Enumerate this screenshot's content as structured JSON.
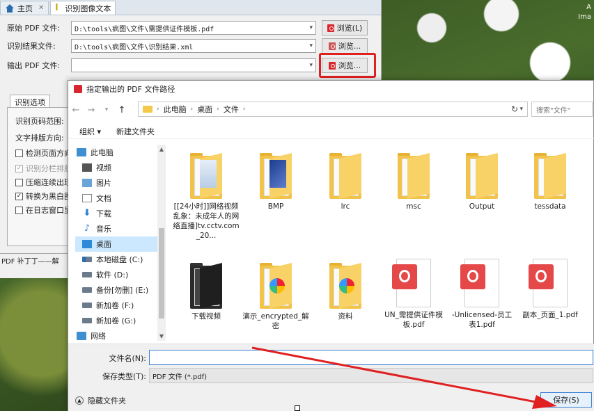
{
  "desktop": {
    "text_line1": "A",
    "text_line2": "Ima"
  },
  "app": {
    "tabs": [
      {
        "label": "主页"
      },
      {
        "label": "识别图像文本"
      }
    ],
    "rows": {
      "source": {
        "label": "原始 PDF 文件:",
        "value": "D:\\tools\\疯图\\文件\\需提供证件模板.pdf",
        "browse": "浏览(L)"
      },
      "result": {
        "label": "识别结果文件:",
        "value": "D:\\tools\\疯图\\文件\\识别结果.xml",
        "browse": "浏览..."
      },
      "output": {
        "label": "输出 PDF 文件:",
        "value": "",
        "browse": "浏览..."
      }
    },
    "options_tab": "识别选项",
    "page_range_label": "识别页码范围:",
    "text_dir_label": "文字排版方向:",
    "checkboxes": [
      {
        "label": "检测页面方向",
        "checked": "",
        "disabled": false
      },
      {
        "label": "识别分栏排版",
        "checked": "✓",
        "disabled": true
      },
      {
        "label": "压缩连续出现",
        "checked": "",
        "disabled": false
      },
      {
        "label": "转换为黑白图",
        "checked": "✓",
        "disabled": false
      },
      {
        "label": "在日志窗口显",
        "checked": "",
        "disabled": false
      }
    ],
    "status": "PDF 补丁丁——解"
  },
  "dialog": {
    "title": "指定输出的 PDF 文件路径",
    "breadcrumb": [
      "此电脑",
      "桌面",
      "文件"
    ],
    "search_placeholder": "搜索\"文件\"",
    "toolbar": {
      "organize": "组织 ▾",
      "new_folder": "新建文件夹"
    },
    "sidebar": [
      {
        "label": "此电脑",
        "icon": "computer-icon"
      },
      {
        "label": "视频",
        "icon": "video-icon"
      },
      {
        "label": "图片",
        "icon": "picture-icon"
      },
      {
        "label": "文档",
        "icon": "document-icon"
      },
      {
        "label": "下载",
        "icon": "download-icon"
      },
      {
        "label": "音乐",
        "icon": "music-icon"
      },
      {
        "label": "桌面",
        "icon": "desktop-icon"
      },
      {
        "label": "本地磁盘 (C:)",
        "icon": "drive-icon"
      },
      {
        "label": "软件 (D:)",
        "icon": "drive-icon"
      },
      {
        "label": "备份[勿删] (E:)",
        "icon": "drive-icon"
      },
      {
        "label": "新加卷 (F:)",
        "icon": "drive-icon"
      },
      {
        "label": "新加卷 (G:)",
        "icon": "drive-icon"
      },
      {
        "label": "网络",
        "icon": "network-icon"
      }
    ],
    "files": [
      {
        "label": "[[24小时]]网络视频乱象：未成年人的网络直播]tv.cctv.com_20...",
        "kind": "folder-doc"
      },
      {
        "label": "BMP",
        "kind": "folder-img"
      },
      {
        "label": "lrc",
        "kind": "folder"
      },
      {
        "label": "msc",
        "kind": "folder"
      },
      {
        "label": "Output",
        "kind": "folder"
      },
      {
        "label": "tessdata",
        "kind": "folder"
      },
      {
        "label": "下载视频",
        "kind": "folder-dark"
      },
      {
        "label": "演示_encrypted_解密",
        "kind": "folder-chart"
      },
      {
        "label": "资料",
        "kind": "folder-chart"
      },
      {
        "label": "UN_需提供证件模板.pdf",
        "kind": "pdf"
      },
      {
        "label": "-Unlicensed-员工表1.pdf",
        "kind": "pdf"
      },
      {
        "label": "副本_页面_1.pdf",
        "kind": "pdf"
      }
    ],
    "filename_label": "文件名(N):",
    "filename_value": "",
    "filetype_label": "保存类型(T):",
    "filetype_value": "PDF 文件 (*.pdf)",
    "hide_folders": "隐藏文件夹",
    "save_button": "保存(S)"
  },
  "colors": {
    "highlight": "#e02020",
    "accent": "#3c7fd6",
    "pdf_red": "#e54848",
    "folder": "#f2c34a"
  }
}
